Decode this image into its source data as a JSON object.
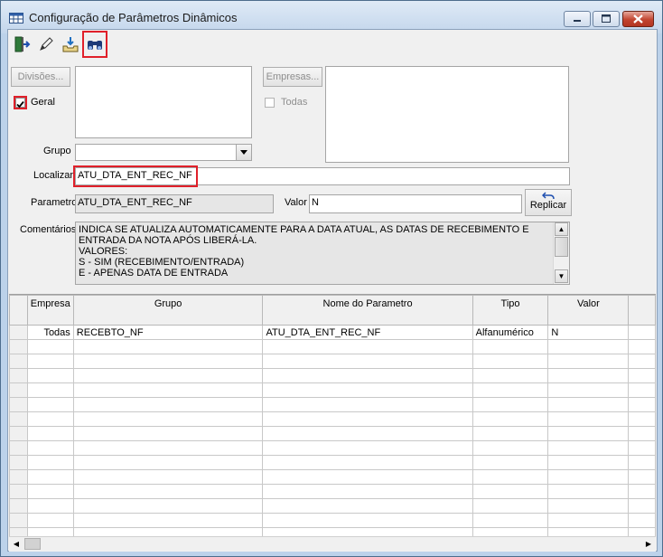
{
  "window": {
    "title": "Configuração de Parâmetros Dinâmicos",
    "accent_color": "#e0202a"
  },
  "toolbar": {
    "buttons": [
      {
        "icon": "exit-door-icon"
      },
      {
        "icon": "pencil-icon"
      },
      {
        "icon": "export-tray-icon"
      },
      {
        "icon": "binoculars-icon"
      }
    ]
  },
  "filters": {
    "divisoes_label": "Divisões...",
    "geral_label": "Geral",
    "geral_checked": true,
    "empresas_label": "Empresas...",
    "todas_label": "Todas",
    "todas_checked": false,
    "grupo_label": "Grupo",
    "grupo_value": ""
  },
  "search": {
    "localizar_label": "Localizar",
    "localizar_value": "ATU_DTA_ENT_REC_NF"
  },
  "detail": {
    "parametro_label": "Parametro",
    "parametro_value": "ATU_DTA_ENT_REC_NF",
    "valor_label": "Valor",
    "valor_value": "N",
    "replicar_label": "Replicar",
    "comentarios_label": "Comentários",
    "comentarios_lines": [
      "INDICA SE ATUALIZA AUTOMATICAMENTE PARA A DATA ATUAL, AS DATAS DE RECEBIMENTO E",
      "ENTRADA DA NOTA APÓS LIBERÁ-LA.",
      "VALORES:",
      "S - SIM (RECEBIMENTO/ENTRADA)",
      "E - APENAS DATA DE ENTRADA"
    ]
  },
  "grid": {
    "columns": [
      "Empresa",
      "Grupo",
      "Nome do Parametro",
      "Tipo",
      "Valor"
    ],
    "rows": [
      [
        "Todas",
        "RECEBTO_NF",
        "ATU_DTA_ENT_REC_NF",
        "Alfanumérico",
        "N"
      ]
    ]
  }
}
